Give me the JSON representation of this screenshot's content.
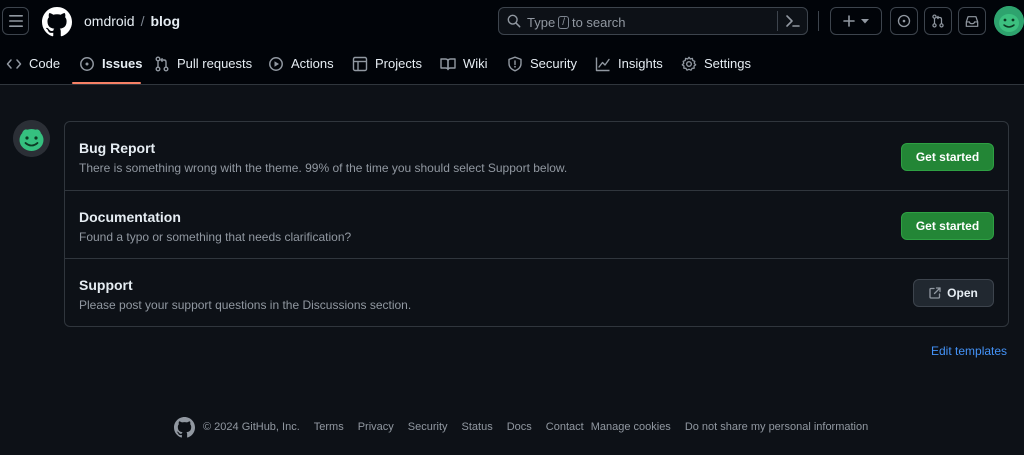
{
  "header": {
    "owner": "omdroid",
    "separator": "/",
    "repo": "blog",
    "search": {
      "prefix": "Type",
      "key": "/",
      "suffix": "to search"
    },
    "icons": [
      "hamburger-icon",
      "github-logo",
      "search-icon",
      "command-palette-icon",
      "plus-icon",
      "triangle-down-icon",
      "issue-opened-icon",
      "git-pull-request-icon",
      "inbox-icon",
      "avatar"
    ]
  },
  "tabs": [
    {
      "label": "Code",
      "icon": "code-icon"
    },
    {
      "label": "Issues",
      "icon": "issue-opened-icon",
      "selected": true
    },
    {
      "label": "Pull requests",
      "icon": "git-pull-request-icon"
    },
    {
      "label": "Actions",
      "icon": "play-icon"
    },
    {
      "label": "Projects",
      "icon": "table-icon"
    },
    {
      "label": "Wiki",
      "icon": "book-icon"
    },
    {
      "label": "Security",
      "icon": "shield-icon"
    },
    {
      "label": "Insights",
      "icon": "graph-icon"
    },
    {
      "label": "Settings",
      "icon": "gear-icon"
    }
  ],
  "templates": [
    {
      "title": "Bug Report",
      "description": "There is something wrong with the theme. 99% of the time you should select Support below.",
      "action": "Get started"
    },
    {
      "title": "Documentation",
      "description": "Found a typo or something that needs clarification?",
      "action": "Get started"
    },
    {
      "title": "Support",
      "description": "Please post your support questions in the Discussions section.",
      "action": "Open"
    }
  ],
  "edit_templates": "Edit templates",
  "footer": {
    "copyright": "© 2024 GitHub, Inc.",
    "links": [
      "Terms",
      "Privacy",
      "Security",
      "Status",
      "Docs",
      "Contact",
      "Manage cookies",
      "Do not share my personal information"
    ]
  },
  "colors": {
    "background": "#0d1117",
    "header_background": "#010409",
    "border": "#30363d",
    "primary_button": "#238636",
    "link": "#4493f8",
    "selected_tab_underline": "#f78166",
    "avatar_green": "#27a36b"
  }
}
